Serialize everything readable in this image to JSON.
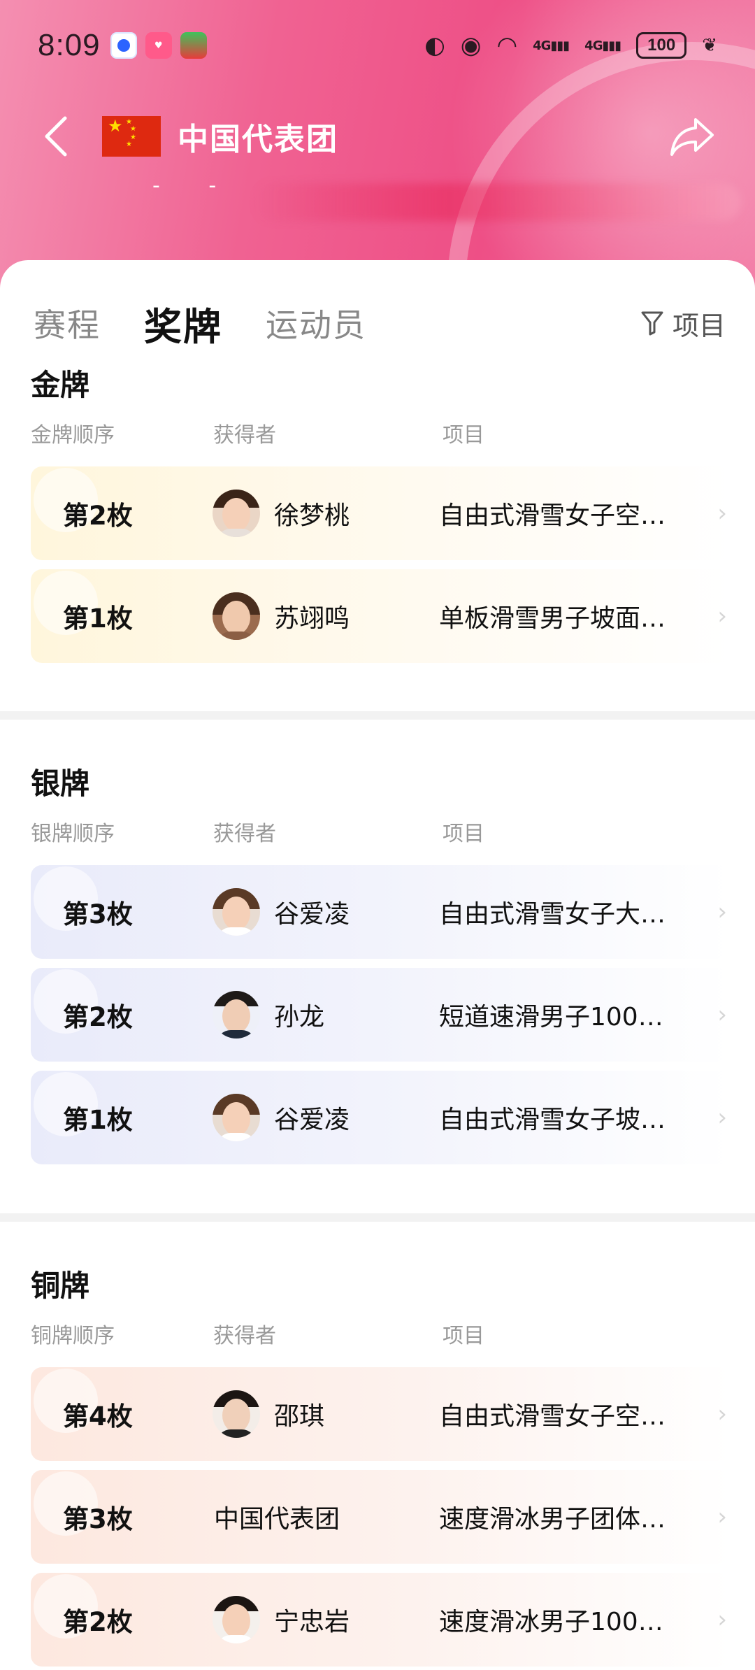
{
  "status": {
    "time": "8:09",
    "signal1": "4G",
    "signal2": "4G",
    "battery": "100"
  },
  "header": {
    "title": "中国代表团",
    "subtitle": "-  -"
  },
  "tabs": [
    {
      "label": "赛程",
      "active": false
    },
    {
      "label": "奖牌",
      "active": true
    },
    {
      "label": "运动员",
      "active": false
    }
  ],
  "filter_label": "项目",
  "gold": {
    "title": "金牌",
    "cols": {
      "order": "金牌顺序",
      "winner": "获得者",
      "event": "项目"
    },
    "rows": [
      {
        "rank": "第2枚",
        "winner": "徐梦桃",
        "event": "自由式滑雪女子空…"
      },
      {
        "rank": "第1枚",
        "winner": "苏翊鸣",
        "event": "单板滑雪男子坡面…"
      }
    ]
  },
  "silver": {
    "title": "银牌",
    "cols": {
      "order": "银牌顺序",
      "winner": "获得者",
      "event": "项目"
    },
    "rows": [
      {
        "rank": "第3枚",
        "winner": "谷爱凌",
        "event": "自由式滑雪女子大…"
      },
      {
        "rank": "第2枚",
        "winner": "孙龙",
        "event": "短道速滑男子100…"
      },
      {
        "rank": "第1枚",
        "winner": "谷爱凌",
        "event": "自由式滑雪女子坡…"
      }
    ]
  },
  "bronze": {
    "title": "铜牌",
    "cols": {
      "order": "铜牌顺序",
      "winner": "获得者",
      "event": "项目"
    },
    "rows": [
      {
        "rank": "第4枚",
        "winner": "邵琪",
        "event": "自由式滑雪女子空…"
      },
      {
        "rank": "第3枚",
        "winner": "中国代表团",
        "event": "速度滑冰男子团体…"
      },
      {
        "rank": "第2枚",
        "winner": "宁忠岩",
        "event": "速度滑冰男子100…"
      }
    ]
  }
}
